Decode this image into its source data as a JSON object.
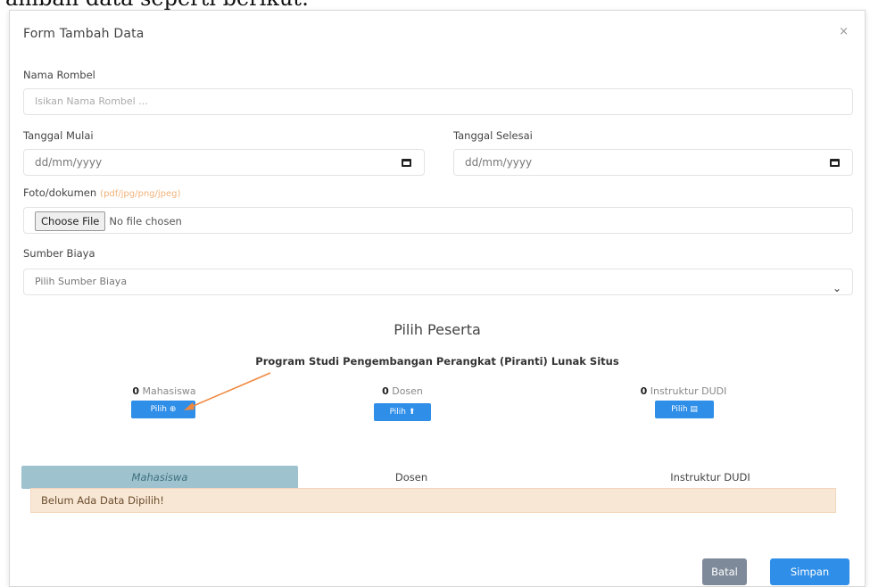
{
  "doc_caption": "ambah data seperti berikut:",
  "modal": {
    "title": "Form Tambah Data",
    "close_glyph": "×"
  },
  "form": {
    "nama_rombel": {
      "label": "Nama Rombel",
      "placeholder": "Isikan Nama Rombel ..."
    },
    "tanggal_mulai": {
      "label": "Tanggal Mulai",
      "value": "dd/mm/yyyy"
    },
    "tanggal_selesai": {
      "label": "Tanggal Selesai",
      "value": "dd/mm/yyyy"
    },
    "foto": {
      "label": "Foto/dokumen",
      "hint": "(pdf/jpg/png/jpeg)",
      "button": "Choose File",
      "status": "No file chosen"
    },
    "sumber_biaya": {
      "label": "Sumber Biaya",
      "selected": "Pilih Sumber Biaya"
    }
  },
  "peserta": {
    "title": "Pilih Peserta",
    "prodi": "Program Studi Pengembangan Perangkat (Piranti) Lunak Situs",
    "groups": [
      {
        "count": "0",
        "label": "Mahasiswa",
        "button": "Pilih ⊕"
      },
      {
        "count": "0",
        "label": "Dosen",
        "button": "Pilih ⬆"
      },
      {
        "count": "0",
        "label": "Instruktur DUDI",
        "button": "Pilih ▤"
      }
    ]
  },
  "tabs": [
    {
      "label": "Mahasiswa",
      "active": true
    },
    {
      "label": "Dosen",
      "active": false
    },
    {
      "label": "Instruktur DUDI",
      "active": false
    }
  ],
  "empty_message": "Belum Ada Data Dipilih!",
  "footer": {
    "batal": "Batal",
    "simpan": "Simpan"
  },
  "colors": {
    "primary": "#2e8ee8",
    "secondary": "#7e8a99",
    "tab_active": "#9ec3cf",
    "alert_bg": "#f9e7d6",
    "annotation_arrow": "#f0883e"
  }
}
